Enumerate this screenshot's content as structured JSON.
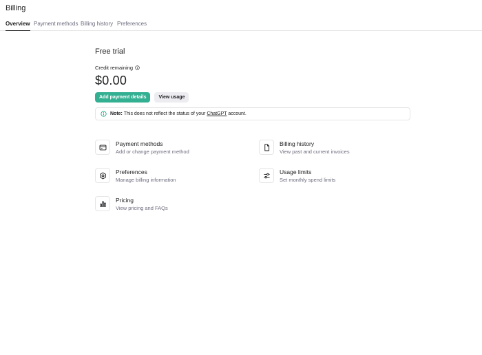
{
  "page": {
    "title": "Billing"
  },
  "tabs": [
    {
      "label": "Overview",
      "active": true
    },
    {
      "label": "Payment methods",
      "active": false
    },
    {
      "label": "Billing history",
      "active": false
    },
    {
      "label": "Preferences",
      "active": false
    }
  ],
  "plan": {
    "title": "Free trial",
    "credit_label": "Credit remaining",
    "balance": "$0.00"
  },
  "buttons": {
    "add_payment": "Add payment details",
    "view_usage": "View usage"
  },
  "note": {
    "prefix": "Note:",
    "text_before": "This does not reflect the status of your",
    "link": "ChatGPT",
    "text_after": "account."
  },
  "cards": [
    {
      "title": "Payment methods",
      "desc": "Add or change payment method",
      "icon": "credit-card-icon"
    },
    {
      "title": "Billing history",
      "desc": "View past and current invoices",
      "icon": "document-icon"
    },
    {
      "title": "Preferences",
      "desc": "Manage billing information",
      "icon": "gear-icon"
    },
    {
      "title": "Usage limits",
      "desc": "Set monthly spend limits",
      "icon": "sliders-icon"
    },
    {
      "title": "Pricing",
      "desc": "View pricing and FAQs",
      "icon": "bar-chart-icon"
    }
  ],
  "colors": {
    "accent": "#10a37f",
    "text": "#202123",
    "muted": "#6e6e80",
    "border": "#e5e5e5"
  }
}
